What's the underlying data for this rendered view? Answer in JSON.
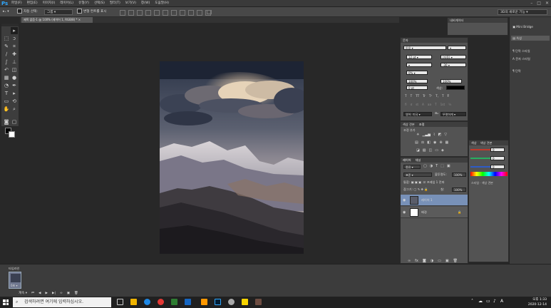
{
  "menubar": {
    "logo": "Ps",
    "items": [
      "파일(F)",
      "편집(E)",
      "이미지(I)",
      "레이어(L)",
      "유형(Y)",
      "선택(S)",
      "필터(T)",
      "보기(V)",
      "창(W)",
      "도움말(H)"
    ],
    "win_controls": [
      "–",
      "□",
      "✕"
    ]
  },
  "options": {
    "auto_select_label": "자동 선택:",
    "auto_select_value": "그룹",
    "transform_label": "변형 컨트롤 표시",
    "workspace": "3D의 새로운 기능"
  },
  "document_tab": {
    "label": "제목 없음-1 @ 100% (레이어 1, RGB/8) *  ×"
  },
  "minibridge": {
    "items": [
      "Mini Bridge",
      "속성"
    ]
  },
  "history_panel_title": "내비게이터",
  "character_panel": {
    "title": "문자",
    "font": "돋움",
    "size": "12 pt",
    "leading": "(자동)",
    "tracking": "-30",
    "scale_pct": "0%",
    "vscale": "100%",
    "hscale": "100%",
    "baseline": "0 pt",
    "color_label": "색상:",
    "lang": "영어: 미국",
    "aa": "뚜렷하게",
    "glyphs": [
      "T",
      "T",
      "TT",
      "Tr",
      "T¹",
      "T,",
      "T",
      "T̶"
    ],
    "glyphs2": [
      "fi",
      "ơ",
      "st",
      "A",
      "aa",
      "T",
      "1st",
      "½"
    ]
  },
  "adjust_panel": {
    "tabs": [
      "색상 견본",
      "조정"
    ],
    "title": "조정 추가"
  },
  "side_dock": {
    "items": [
      "단락 스타일",
      "문자 스타일",
      "단락"
    ]
  },
  "layers_panel": {
    "tabs": [
      "레이어",
      "채널"
    ],
    "kind": "종류",
    "blend": "표준",
    "opacity_label": "불투명도:",
    "opacity": "100%",
    "lock_label": "잠그기:",
    "fill_label": "칠:",
    "fill": "100%",
    "unify_label": "프레임 1 전파",
    "layers": [
      {
        "name": "레이어 1",
        "selected": true
      },
      {
        "name": "배경",
        "selected": false
      }
    ]
  },
  "color_panel": {
    "tabs": [
      "색상",
      "색상 견본"
    ],
    "values": [
      "0",
      "0",
      "0"
    ]
  },
  "filmstrip": {
    "title": "타임라인",
    "frame_time": "0초 ▾",
    "loop": "계속 ▾"
  },
  "taskbar": {
    "search_placeholder": "검색하려면 여기에 입력하십시오.",
    "ime": "A",
    "time": "오후 1:33",
    "date": "2020-12-14"
  },
  "colors": {
    "accent": "#2fa8ff",
    "selected_layer": "#7891b8",
    "panel_bg": "#535353",
    "workspace_bg": "#282828"
  }
}
